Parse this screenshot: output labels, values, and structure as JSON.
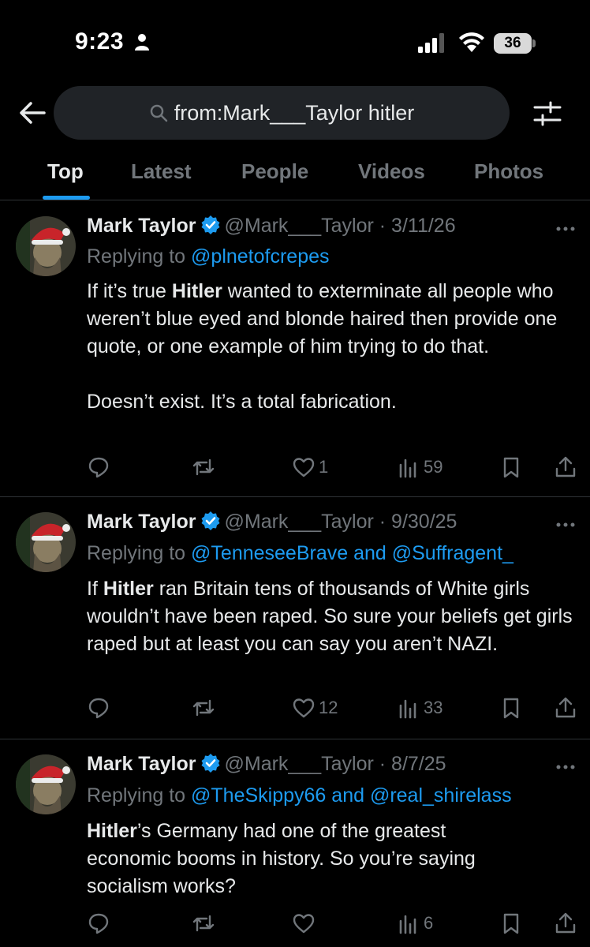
{
  "status": {
    "time": "9:23",
    "battery": "36"
  },
  "search": {
    "query": "from:Mark___Taylor hitler"
  },
  "tabs": [
    "Top",
    "Latest",
    "People",
    "Videos",
    "Photos"
  ],
  "tweets": [
    {
      "name": "Mark Taylor",
      "handle": "@Mark___Taylor",
      "dot": " · ",
      "date": "3/11/26",
      "replying_prefix": "Replying to ",
      "mention1": "@plnetofcrepes",
      "and": "",
      "mention2": "",
      "body_p1_bold": "Hitler",
      "body_p1_pre": "If it’s true ",
      "body_p1_post": " wanted to exterminate all people who weren’t blue eyed and blonde haired then provide one quote, or one example of him trying to do that.",
      "body_p2": "Doesn’t exist. It’s a total fabrication.",
      "likes": "1",
      "views": "59"
    },
    {
      "name": "Mark Taylor",
      "handle": "@Mark___Taylor",
      "dot": " · ",
      "date": "9/30/25",
      "replying_prefix": "Replying to ",
      "mention1": "@TenneseeBrave",
      "and": " and ",
      "mention2": "@Suffragent_",
      "body_p1_pre": "If ",
      "body_p1_bold": "Hitler",
      "body_p1_post": " ran Britain tens of thousands of White girls wouldn’t have been raped. So sure your beliefs get girls raped but at least you can say you aren’t NAZI.",
      "likes": "12",
      "views": "33"
    },
    {
      "name": "Mark Taylor",
      "handle": "@Mark___Taylor",
      "dot": " · ",
      "date": "8/7/25",
      "replying_prefix": "Replying to ",
      "mention1": "@TheSkippy66",
      "and": " and ",
      "mention2": "@real_shirelass",
      "body_p1_pre": "",
      "body_p1_bold": "Hitler",
      "body_p1_post": "’s Germany had one of the greatest economic booms in history. So you’re saying socialism works?",
      "likes": "",
      "views": "6"
    }
  ],
  "colors": {
    "background": "#000000",
    "accent": "#1d9bf0",
    "muted": "#71767b",
    "text": "#e7e9ea"
  }
}
